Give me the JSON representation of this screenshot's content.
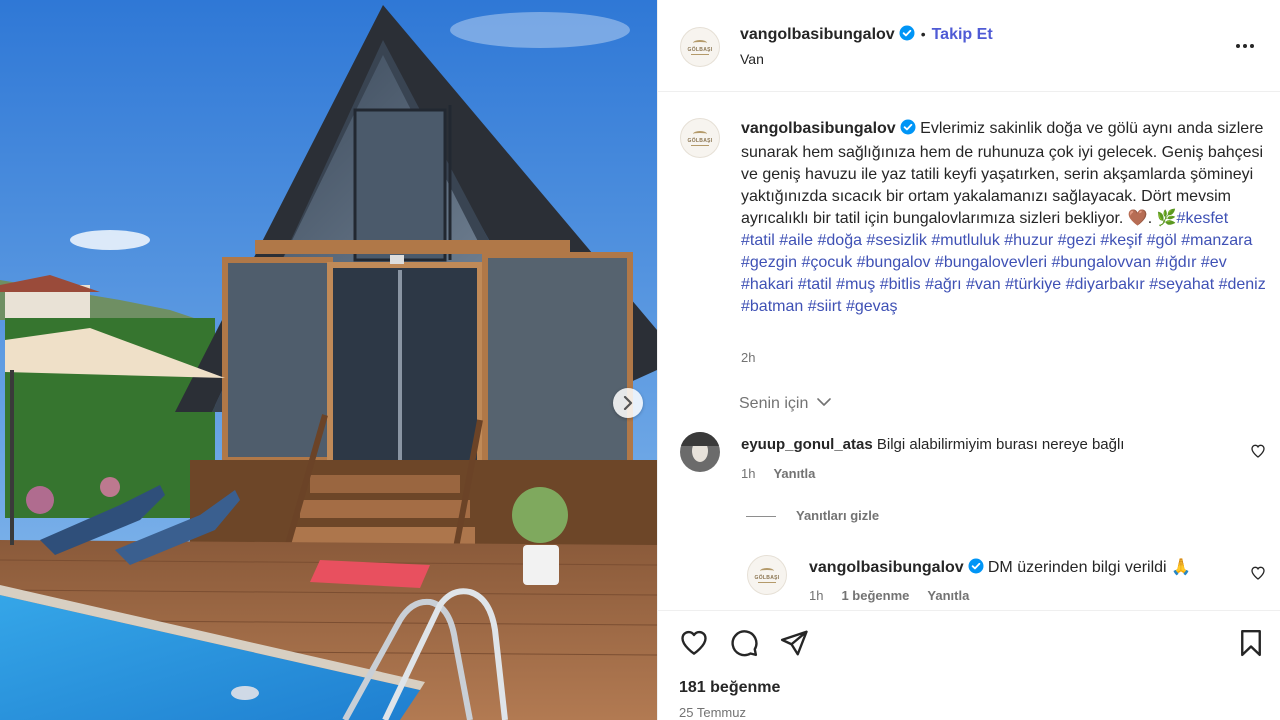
{
  "post": {
    "username": "vangolbasibungalov",
    "follow_label": "Takip Et",
    "dot": "•",
    "location": "Van",
    "avatar_logo_text": "GÖLBAŞI",
    "caption_text": "Evlerimiz sakinlik doğa ve gölü aynı anda sizlere sunarak hem sağlığınıza hem de ruhunuza çok iyi gelecek. Geniş bahçesi ve geniş havuzu ile yaz tatili keyfi yaşatırken, serin akşamlarda şömineyi yaktığınızda sıcacık bir ortam yakalamanızı sağlayacak. Dört mevsim ayrıcalıklı bir tatil için bungalovlarımıza sizleri bekliyor. 🤎. 🌿",
    "hashtags": "#kesfet #tatil #aile #doğa #sesizlik #mutluluk #huzur #gezi #keşif #göl #manzara #gezgin #çocuk #bungalov #bungalovevleri #bungalovvan #ığdır #ev #hakari #tatil #muş #bitlis #ağrı #van #türkiye #diyarbakır #seyahat #deniz #batman #siirt #gevaş",
    "caption_time": "2h"
  },
  "comments_filter": "Senin için",
  "comments": [
    {
      "username": "eyuup_gonul_atas",
      "text": "Bilgi alabilirmiyim burası nereye bağlı",
      "time": "1h",
      "reply_label": "Yanıtla"
    }
  ],
  "hide_replies_label": "Yanıtları gizle",
  "reply": {
    "username": "vangolbasibungalov",
    "text": "DM üzerinden bilgi verildi 🙏",
    "time": "1h",
    "likes_label": "1 beğenme",
    "reply_label": "Yanıtla"
  },
  "footer": {
    "likes": "181 beğenme",
    "date": "25 Temmuz"
  },
  "colors": {
    "link": "#3f51b5",
    "follow": "#4f5bd5",
    "muted": "#737373",
    "verified": "#0095f6"
  },
  "icons": [
    "verified-icon",
    "more-options-icon",
    "heart-icon",
    "comment-icon",
    "share-icon",
    "save-icon",
    "chevron-right-icon",
    "chevron-down-icon"
  ]
}
